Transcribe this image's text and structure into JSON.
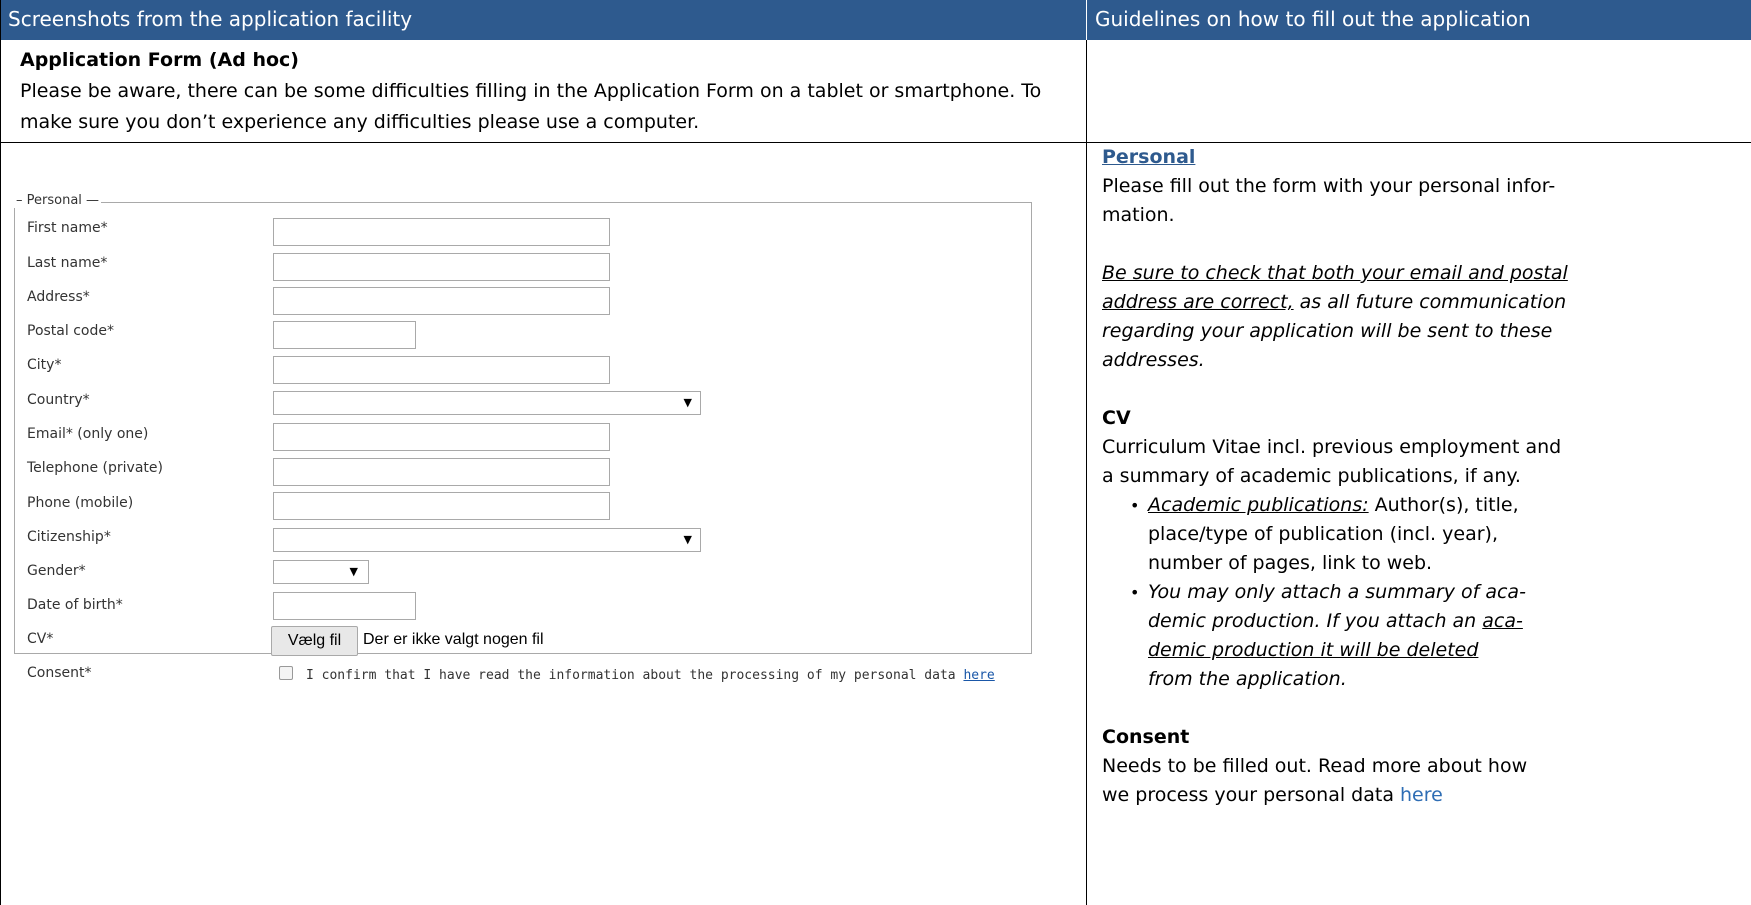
{
  "header": {
    "left_title": "Screenshots from the application facility",
    "right_title": "Guidelines on how to fill out the application"
  },
  "intro": {
    "heading": "Application Form (Ad hoc)",
    "line1": "Please be aware, there can be some difficulties filling in the Application Form on a tablet or smartphone. To",
    "line2": "make sure you don’t experience any difficulties please use a computer."
  },
  "form": {
    "legend": "Personal",
    "fields": [
      {
        "label": "First name*",
        "value": ""
      },
      {
        "label": "Last name*",
        "value": ""
      },
      {
        "label": "Address*",
        "value": ""
      },
      {
        "label": "Postal code*",
        "value": ""
      },
      {
        "label": "City*",
        "value": ""
      },
      {
        "label": "Country*",
        "value": ""
      },
      {
        "label": "Email* (only one)",
        "value": ""
      },
      {
        "label": "Telephone (private)",
        "value": ""
      },
      {
        "label": "Phone (mobile)",
        "value": ""
      },
      {
        "label": "Citizenship*",
        "value": ""
      },
      {
        "label": "Gender*",
        "value": ""
      },
      {
        "label": "Date of birth*",
        "value": ""
      },
      {
        "label": "CV*",
        "value": ""
      },
      {
        "label": "Consent*",
        "value": ""
      }
    ],
    "select_arrow": "▼",
    "file_button": "Vælg fil",
    "file_status": "Der er ikke valgt nogen fil",
    "consent_text": "I confirm that I have read the information about the processing of my personal data",
    "consent_link": "here"
  },
  "guidelines": {
    "personal_heading": "Personal",
    "personal_l1": "Please fill out the form with your personal infor-",
    "personal_l2": "mation.",
    "note_l1": "Be sure to check that both your email and postal",
    "note_l2a": "address are correct,",
    "note_l2b": " as all future communication",
    "note_l3": "regarding your application will be sent to these",
    "note_l4": "addresses.",
    "cv_heading": "CV",
    "cv_l1": "Curriculum Vitae incl. previous employment and",
    "cv_l2": "a summary of academic publications, if any.",
    "b1_l1a": "Academic publications:",
    "b1_l1b": " Author(s), title,",
    "b1_l2": "place/type of publication (incl. year),",
    "b1_l3": "number of pages, link to web.",
    "b2_l1": "You may only attach a summary of aca-",
    "b2_l2a": "demic production. If you attach an ",
    "b2_l2b": "aca-",
    "b2_l3": "demic production it will be deleted",
    "b2_l4": "from the application.",
    "consent_heading": "Consent",
    "consent_l1": "Needs to be filled out. Read more about how",
    "consent_l2a": "we process your personal data ",
    "consent_l2b": "here",
    "bullet_char": "•"
  }
}
